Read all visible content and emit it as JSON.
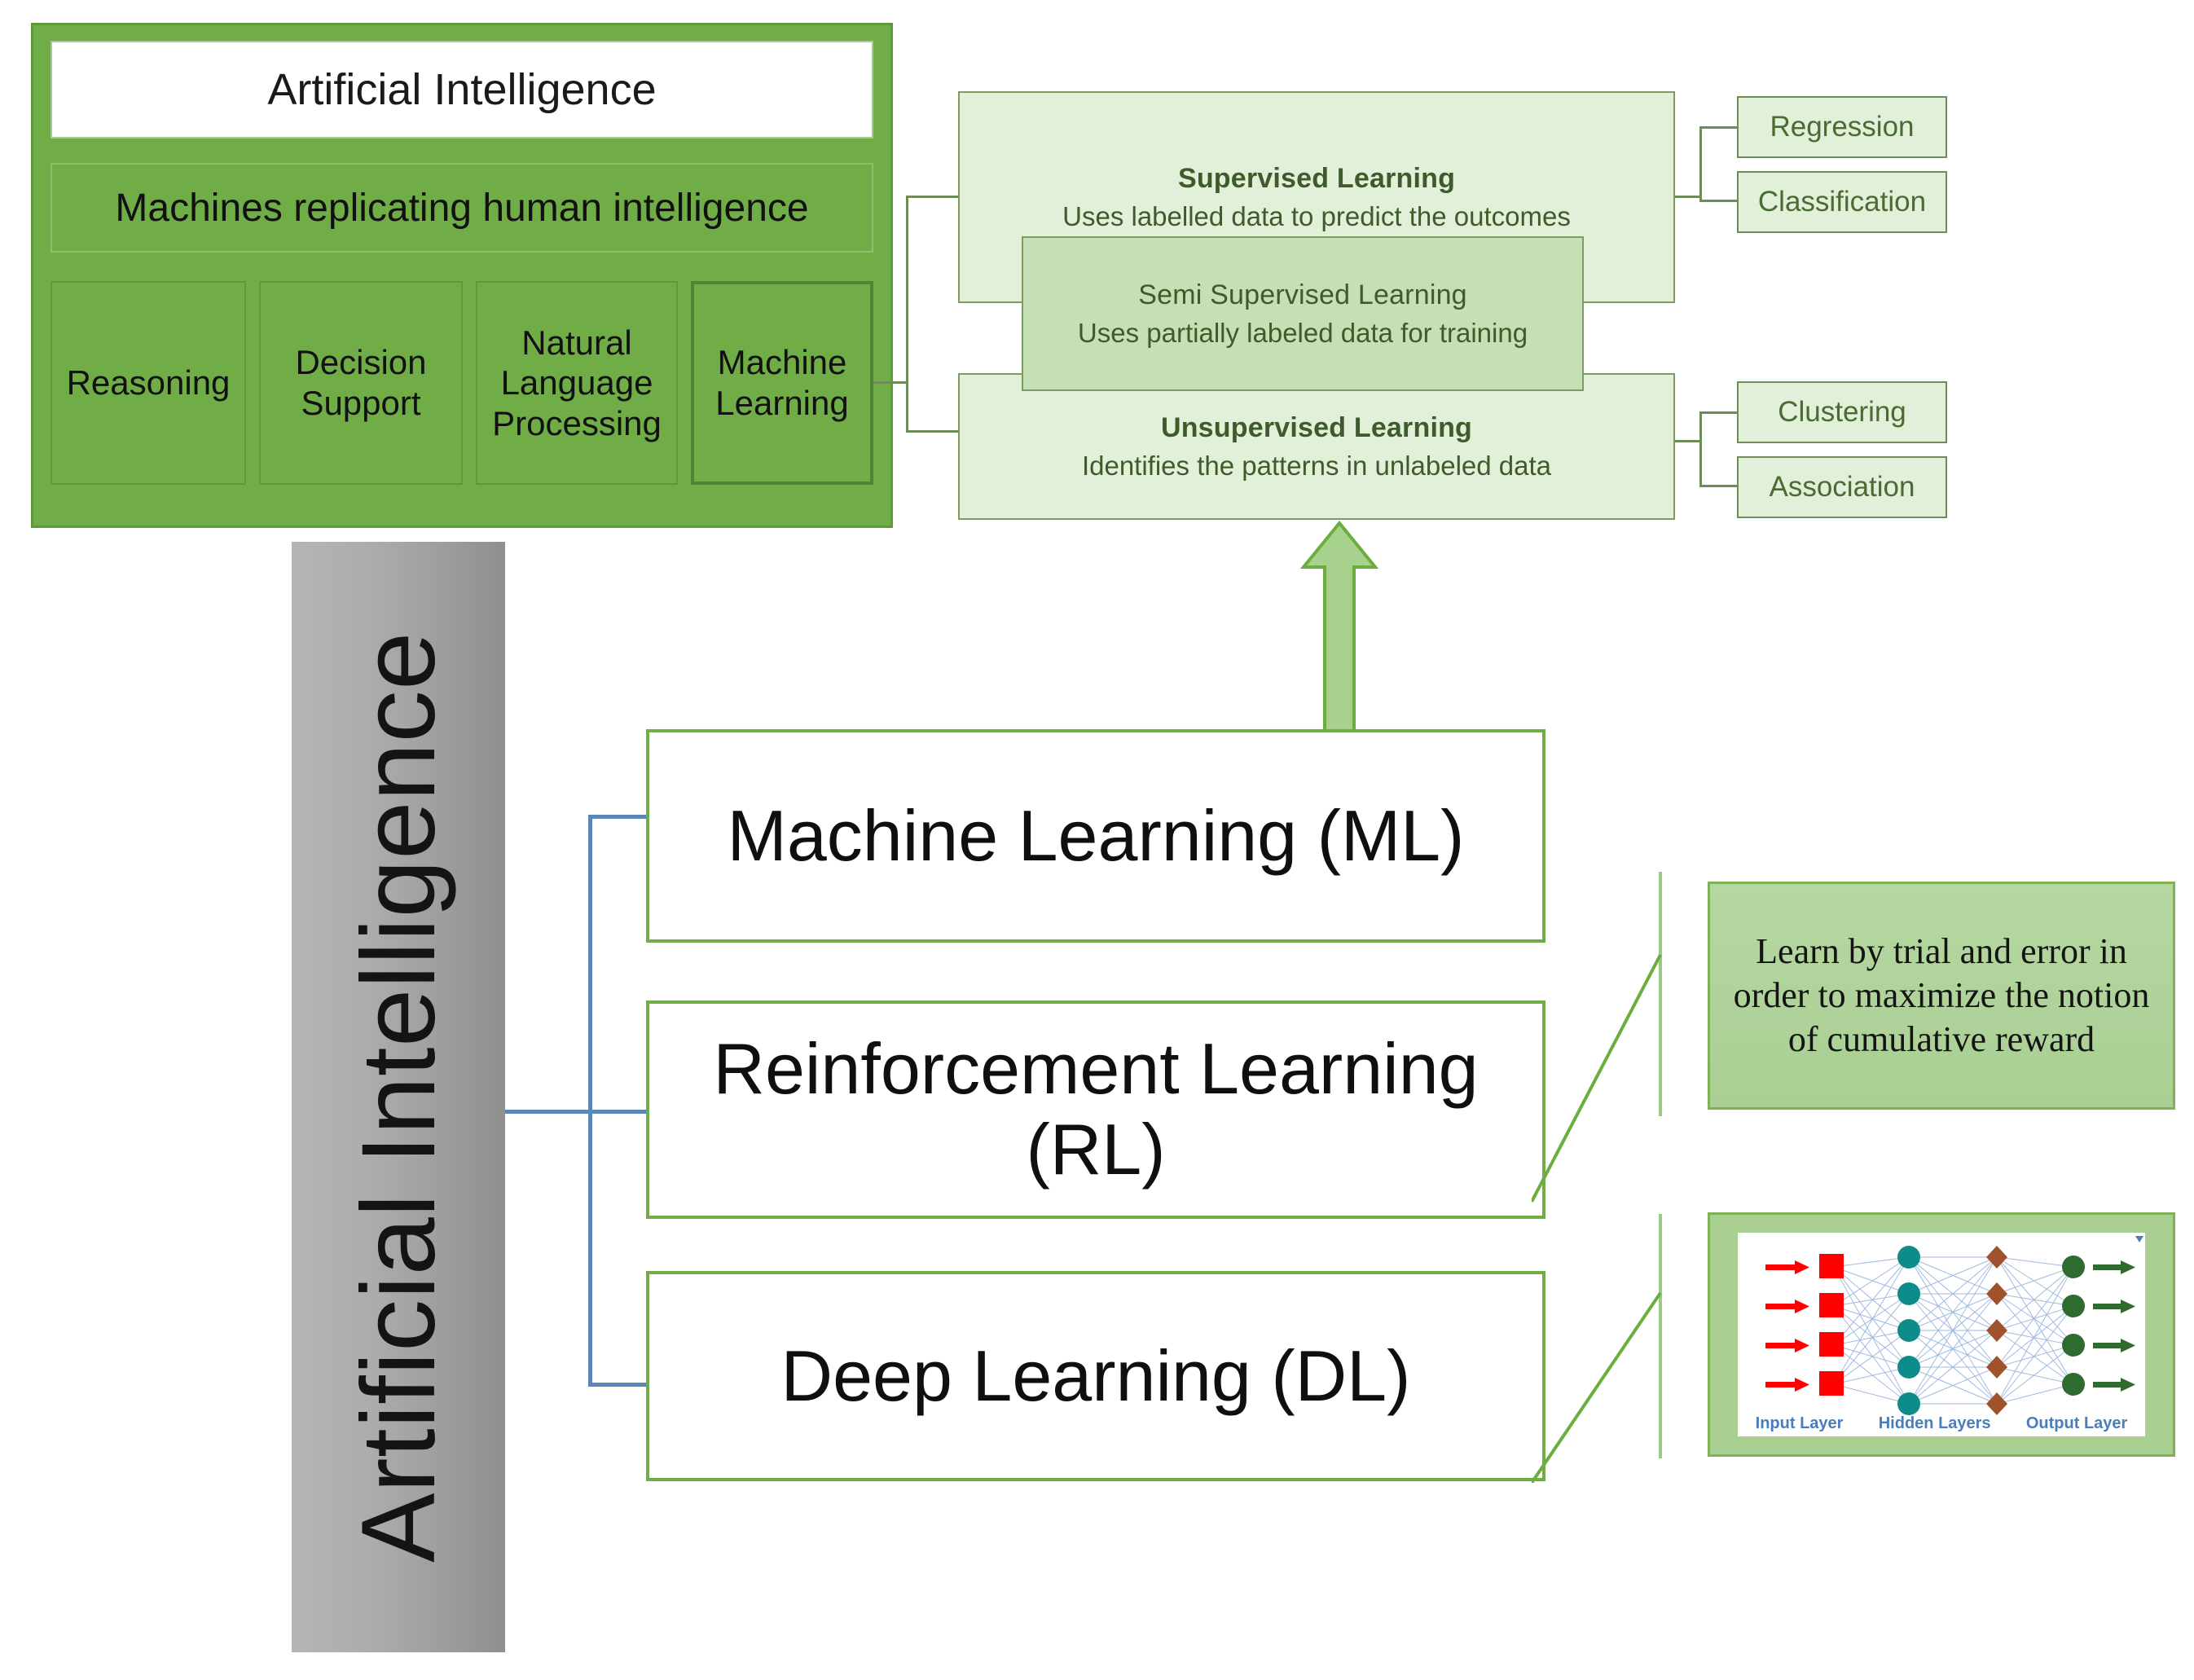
{
  "ai_group": {
    "title": "Artificial Intelligence",
    "subtitle": "Machines replicating human intelligence",
    "pillars": [
      {
        "label": "Reasoning"
      },
      {
        "label": "Decision Support"
      },
      {
        "label": "Natural Language Processing"
      },
      {
        "label": "Machine Learning"
      }
    ]
  },
  "ml_taxonomy": {
    "supervised": {
      "title": "Supervised Learning",
      "desc": "Uses labelled data to predict the outcomes",
      "children": [
        "Regression",
        "Classification"
      ]
    },
    "semi_supervised": {
      "title": "Semi Supervised Learning",
      "desc": "Uses partially labeled data for training"
    },
    "unsupervised": {
      "title": "Unsupervised Learning",
      "desc": "Identifies the patterns in unlabeled data",
      "children": [
        "Clustering",
        "Association"
      ]
    }
  },
  "vertical_bar": {
    "label": "Artificial Intelligence"
  },
  "branches": [
    {
      "label": "Machine Learning (ML)"
    },
    {
      "label": "Reinforcement Learning (RL)"
    },
    {
      "label": "Deep Learning (DL)"
    }
  ],
  "callouts": {
    "rl_description": "Learn by trial and error in order to maximize the notion of cumulative reward",
    "dl_network": {
      "input_layer_label": "Input Layer",
      "hidden_layers_label": "Hidden Layers",
      "output_layer_label": "Output Layer",
      "input_nodes": 4,
      "hidden_layer_1_nodes": 5,
      "hidden_layer_2_nodes": 5,
      "output_nodes": 4
    }
  },
  "colors": {
    "ai_green": "#70AD47",
    "light_green_box": "#E2EFD9",
    "mid_green_box": "#C5E0B4",
    "callout_green": "#A9CF93",
    "connector_blue": "#5B87B8",
    "connector_green": "#6E8C57",
    "bar_gray": "#ADADAD",
    "nn_input_red": "#FF0000",
    "nn_hidden_teal": "#0E8C8C",
    "nn_hidden_brown": "#A0522D",
    "nn_output_green": "#2E6B2E",
    "nn_edge_blue": "#8FAEDB",
    "nn_label_blue": "#4A7EBB"
  }
}
